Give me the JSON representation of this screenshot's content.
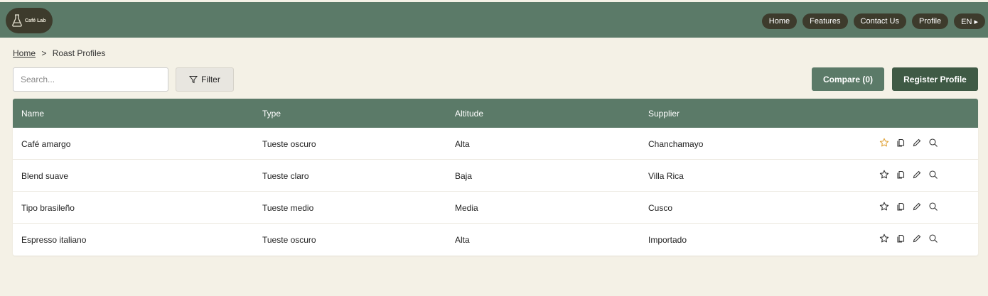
{
  "header": {
    "logo_text": "Café Lab",
    "nav": [
      "Home",
      "Features",
      "Contact Us",
      "Profile",
      "EN ▸"
    ]
  },
  "breadcrumb": {
    "home": "Home",
    "separator": ">",
    "current": "Roast Profiles"
  },
  "toolbar": {
    "search_placeholder": "Search...",
    "filter_label": "Filter",
    "compare_label": "Compare (0)",
    "register_label": "Register Profile"
  },
  "table": {
    "columns": [
      "Name",
      "Type",
      "Altitude",
      "Supplier"
    ],
    "rows": [
      {
        "name": "Café amargo",
        "type": "Tueste oscuro",
        "altitude": "Alta",
        "supplier": "Chanchamayo",
        "favorite": true
      },
      {
        "name": "Blend suave",
        "type": "Tueste claro",
        "altitude": "Baja",
        "supplier": "Villa Rica",
        "favorite": false
      },
      {
        "name": "Tipo brasileño",
        "type": "Tueste medio",
        "altitude": "Media",
        "supplier": "Cusco",
        "favorite": false
      },
      {
        "name": "Espresso italiano",
        "type": "Tueste oscuro",
        "altitude": "Alta",
        "supplier": "Importado",
        "favorite": false
      }
    ],
    "action_icons": [
      "star-icon",
      "copy-icon",
      "pencil-icon",
      "search-icon"
    ]
  },
  "colors": {
    "header": "#5b7a68",
    "dark_pill": "#3d3b2c",
    "register": "#3f5a45",
    "background": "#f4f1e6",
    "favorite_star": "#e0a43c"
  }
}
